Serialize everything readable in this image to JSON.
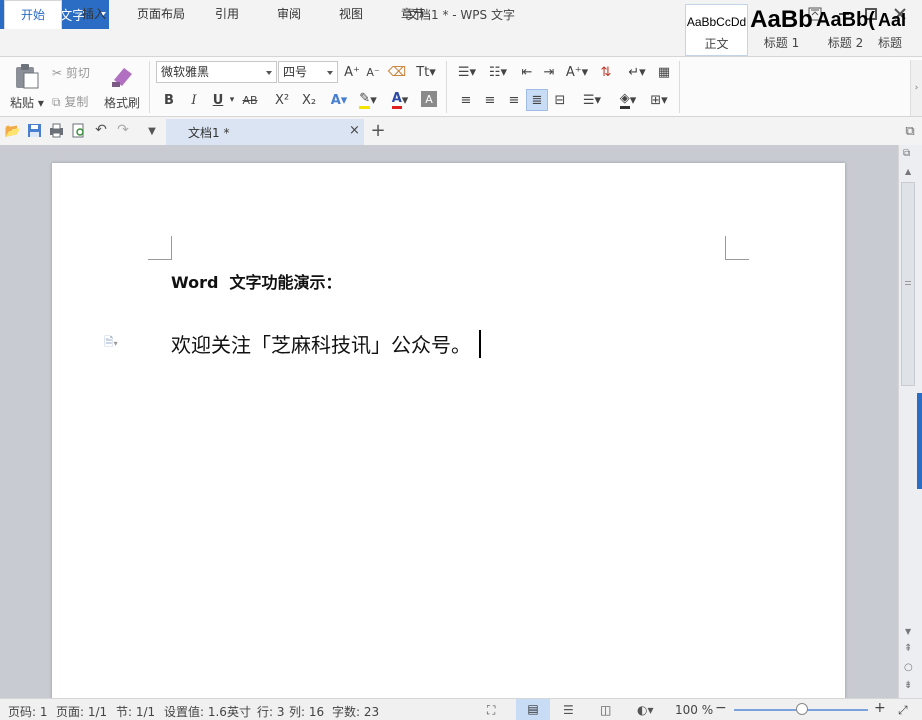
{
  "app": {
    "name": "WPS 文字",
    "window_title": "文档1 * - WPS 文字",
    "accent_color": "#2b6cc4"
  },
  "ribbon_tabs": [
    "开始",
    "插入",
    "页面布局",
    "引用",
    "审阅",
    "视图",
    "章节"
  ],
  "active_tab": "开始",
  "clipboard": {
    "paste": "粘贴",
    "cut": "剪切",
    "copy": "复制",
    "format_painter": "格式刷"
  },
  "font": {
    "family": "微软雅黑",
    "size": "四号"
  },
  "format_buttons": {
    "bold": "B",
    "italic": "I",
    "underline": "U",
    "strike": "AB",
    "superscript": "X²",
    "subscript": "X₂",
    "font_color": "A"
  },
  "styles": [
    {
      "preview": "AaBbCcDd",
      "name": "正文"
    },
    {
      "preview": "AaBb",
      "name": "标题 1"
    },
    {
      "preview": "AaBb(",
      "name": "标题 2"
    },
    {
      "preview": "AaI",
      "name": "标题"
    }
  ],
  "document_tab": {
    "label": "文档1 *"
  },
  "document": {
    "heading": "Word  文字功能演示：",
    "body": "欢迎关注「芝麻科技讯」公众号。"
  },
  "status": {
    "page": "页码: 1",
    "page_of": "页面: 1/1",
    "section": "节: 1/1",
    "setting": "设置值: 1.6英寸",
    "line": "行: 3",
    "column": "列: 16",
    "word_count": "字数: 23",
    "zoom": "100 %"
  }
}
